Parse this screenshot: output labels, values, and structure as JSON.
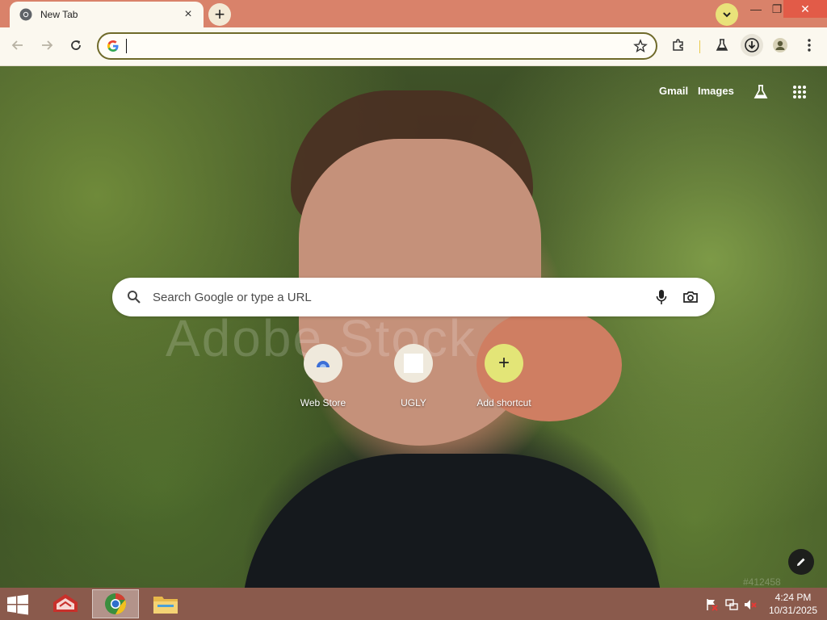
{
  "tab": {
    "title": "New Tab",
    "close_glyph": "×",
    "favicon": "chrome-icon"
  },
  "new_tab_glyph": "+",
  "window_controls": {
    "minimize_glyph": "—",
    "restore_glyph": "❐",
    "close_glyph": "✕"
  },
  "omnibox": {
    "value": "",
    "placeholder": ""
  },
  "ntp": {
    "links": [
      "Gmail",
      "Images"
    ],
    "search_placeholder": "Search Google or type a URL",
    "shortcuts": [
      {
        "label": "Web Store",
        "icon": "web-store-icon"
      },
      {
        "label": "UGLY",
        "icon": "blank-page-icon"
      },
      {
        "label": "Add shortcut",
        "icon": "plus-icon",
        "glyph": "+"
      }
    ]
  },
  "background": {
    "watermark_text": "Adobe Stock",
    "corner_watermark": "#412458"
  },
  "taskbar": {
    "apps": [
      "start-icon",
      "app-red-icon",
      "chrome-icon",
      "file-explorer-icon"
    ],
    "tray": [
      "flag-icon",
      "network-icon",
      "volume-muted-icon"
    ],
    "time": "4:24 PM",
    "date": "10/31/2025"
  },
  "colors": {
    "tab_strip": "#d9826a",
    "toolbar": "#fbf8ef",
    "omnibox_border": "#6f6a2a",
    "accent_yellow": "#e9e27a",
    "close_red": "#e25b48",
    "taskbar": "#8a5a4c"
  }
}
